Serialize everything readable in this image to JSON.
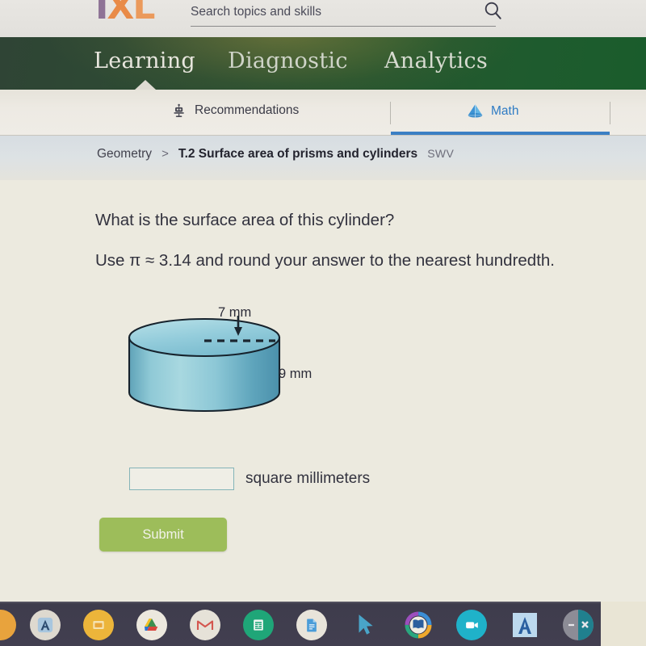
{
  "header": {
    "logo_i": "I",
    "logo_x": "X",
    "logo_l": "L",
    "search_placeholder": "Search topics and skills",
    "search_value": "",
    "search_icon": "search-icon"
  },
  "green_nav": {
    "items": [
      {
        "label": "Learning",
        "active": true
      },
      {
        "label": "Diagnostic",
        "active": false
      },
      {
        "label": "Analytics",
        "active": false
      }
    ]
  },
  "tabs": [
    {
      "label": "Recommendations",
      "icon": "robot-icon",
      "active": false
    },
    {
      "label": "Math",
      "icon": "prism-icon",
      "active": true
    }
  ],
  "breadcrumb": {
    "category": "Geometry",
    "separator": ">",
    "skill": "T.2 Surface area of prisms and cylinders",
    "code": "SWV"
  },
  "question": {
    "line1": "What is the surface area of this cylinder?",
    "line2": "Use π ≈ 3.14 and round your answer to the nearest hundredth."
  },
  "figure": {
    "shape": "cylinder",
    "radius_label": "7 mm",
    "height_label": "9 mm",
    "radius_value": 7,
    "height_value": 9,
    "units": "mm",
    "body_color": "#6eb4c6",
    "top_color": "#9fd4de",
    "outline_color": "#1b2630"
  },
  "answer": {
    "value": "",
    "placeholder": "",
    "unit_label": "square millimeters"
  },
  "submit": {
    "label": "Submit",
    "color": "#9dbd5a"
  },
  "taskbar": {
    "icons": [
      {
        "name": "partial-orange-app-icon",
        "color": "#e8a33d"
      },
      {
        "name": "acellus-app-icon",
        "color": "#5b7fa6"
      },
      {
        "name": "amber-window-app-icon",
        "color": "#ecb53a"
      },
      {
        "name": "google-drive-icon",
        "color": "#fbbc04"
      },
      {
        "name": "gmail-icon",
        "color": "#ea4335"
      },
      {
        "name": "google-sheets-icon",
        "color": "#1fa463"
      },
      {
        "name": "google-docs-icon",
        "color": "#3b8ed6"
      },
      {
        "name": "cursor-arrow-icon",
        "color": "#4aa3c7"
      },
      {
        "name": "epic-books-icon",
        "color": "#f0a92c"
      },
      {
        "name": "zoom-icon",
        "color": "#1fb2c9"
      },
      {
        "name": "acellus-blue-icon",
        "color": "#2f6fb5"
      },
      {
        "name": "window-controls-icon",
        "color": "#8c8c96"
      }
    ]
  }
}
